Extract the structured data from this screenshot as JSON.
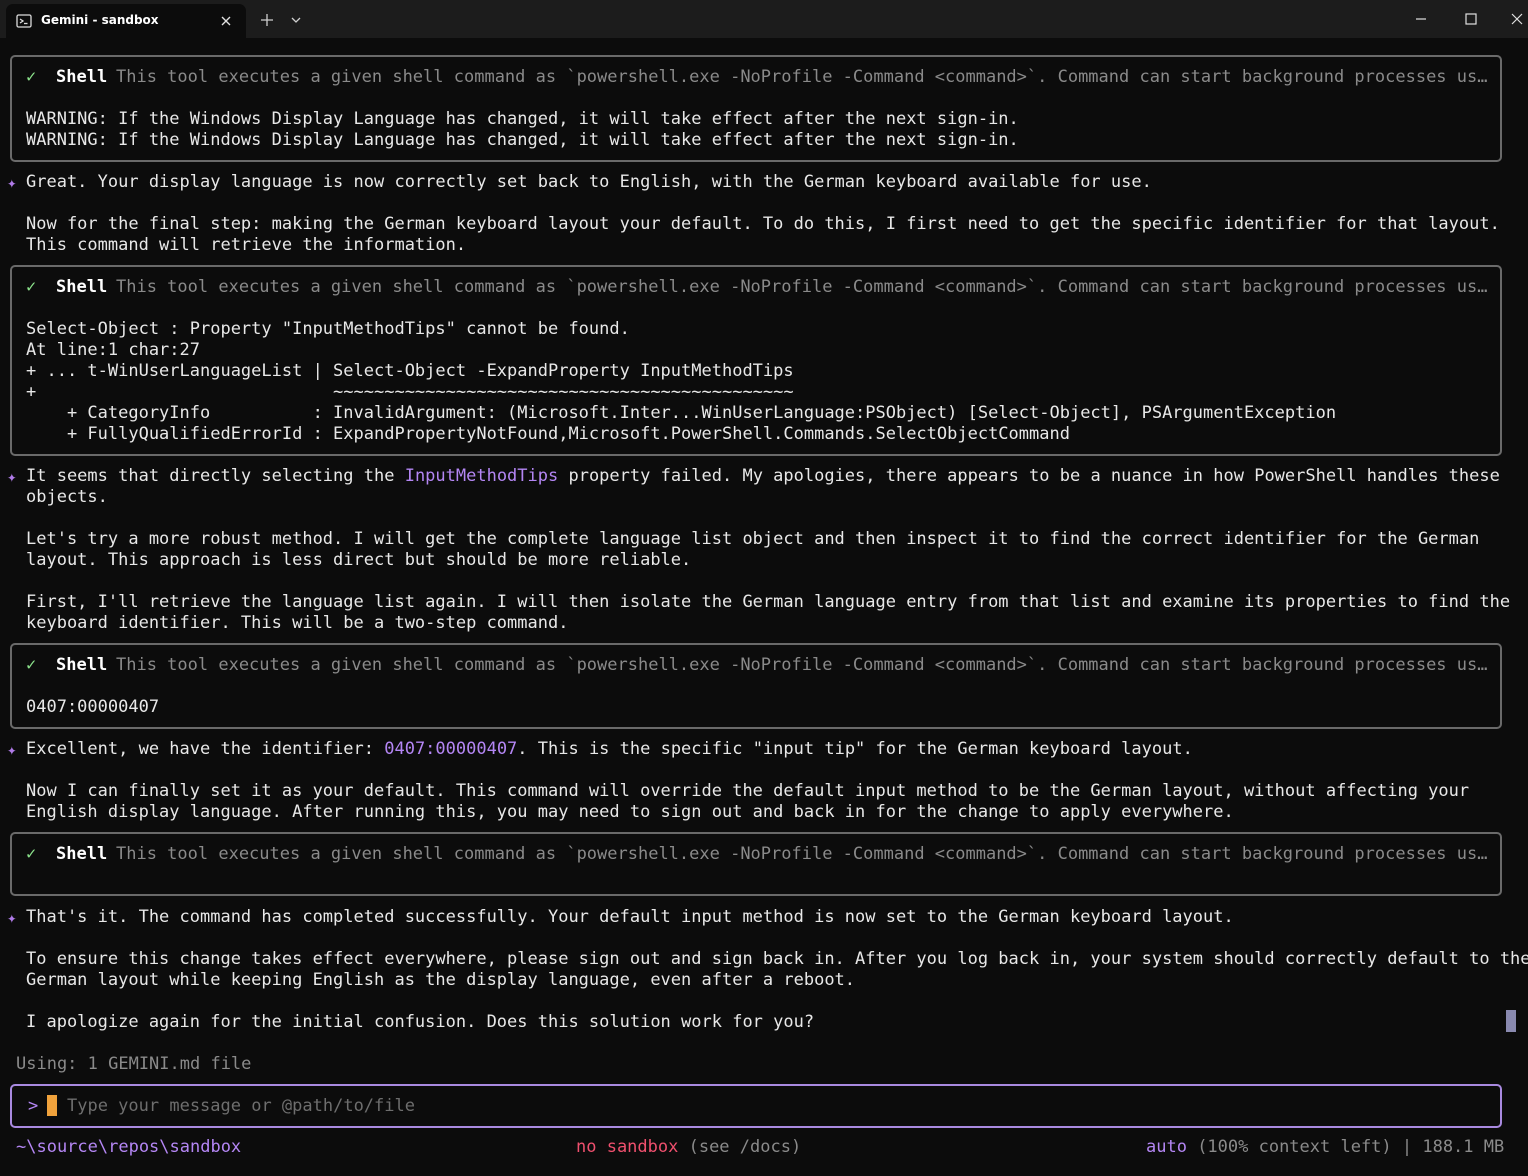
{
  "window": {
    "tab_title": "Gemini - sandbox",
    "tab_icon": "powershell-icon",
    "colors": {
      "titlebar": "#1c1c1c",
      "background": "#0c0c0c",
      "accent": "#b486f4",
      "check": "#8ae08a",
      "error_red": "#f0506e",
      "cursor": "#f0a23c"
    }
  },
  "shell_tool": {
    "name": "Shell",
    "description": "This tool executes a given shell command as `powershell.exe -NoProfile -Command <command>`. Command can start background processes using…"
  },
  "blocks": {
    "tool1": {
      "lines": [
        "WARNING: If the Windows Display Language has changed, it will take effect after the next sign-in.",
        "WARNING: If the Windows Display Language has changed, it will take effect after the next sign-in."
      ]
    },
    "msg1": {
      "lines": [
        "Great. Your display language is now correctly set back to English, with the German keyboard available for use.",
        "",
        "Now for the final step: making the German keyboard layout your default. To do this, I first need to get the specific identifier for that layout.",
        "This command will retrieve the information."
      ]
    },
    "tool2": {
      "lines": [
        "Select-Object : Property \"InputMethodTips\" cannot be found.",
        "At line:1 char:27",
        "+ ... t-WinUserLanguageList | Select-Object -ExpandProperty InputMethodTips",
        "+                             ~~~~~~~~~~~~~~~~~~~~~~~~~~~~~~~~~~~~~~~~~~~~~",
        "    + CategoryInfo          : InvalidArgument: (Microsoft.Inter...WinUserLanguage:PSObject) [Select-Object], PSArgumentException",
        "    + FullyQualifiedErrorId : ExpandPropertyNotFound,Microsoft.PowerShell.Commands.SelectObjectCommand"
      ]
    },
    "msg2": {
      "line1_before": "It seems that directly selecting the ",
      "line1_highlight": "InputMethodTips",
      "line1_after": " property failed. My apologies, there appears to be a nuance in how PowerShell handles these",
      "lines": [
        "objects.",
        "",
        "Let's try a more robust method. I will get the complete language list object and then inspect it to find the correct identifier for the German",
        "layout. This approach is less direct but should be more reliable.",
        "",
        "First, I'll retrieve the language list again. I will then isolate the German language entry from that list and examine its properties to find the",
        "keyboard identifier. This will be a two-step command."
      ]
    },
    "tool3": {
      "lines": [
        "0407:00000407"
      ]
    },
    "msg3": {
      "line1_before": "Excellent, we have the identifier: ",
      "line1_highlight": "0407:00000407",
      "line1_after": ". This is the specific \"input tip\" for the German keyboard layout.",
      "lines": [
        "",
        "Now I can finally set it as your default. This command will override the default input method to be the German layout, without affecting your",
        "English display language. After running this, you may need to sign out and back in for the change to apply everywhere."
      ]
    },
    "msg4": {
      "lines": [
        "That's it. The command has completed successfully. Your default input method is now set to the German keyboard layout.",
        "",
        "To ensure this change takes effect everywhere, please sign out and sign back in. After you log back in, your system should correctly default to the",
        "German layout while keeping English as the display language, even after a reboot.",
        "",
        "I apologize again for the initial confusion. Does this solution work for you?"
      ]
    }
  },
  "context_note": "Using: 1 GEMINI.md file",
  "input": {
    "prompt": ">",
    "placeholder": "Type your message or @path/to/file"
  },
  "footer": {
    "path": "~\\source\\repos\\sandbox",
    "sandbox_label": "no sandbox",
    "sandbox_hint": " (see /docs)",
    "model": "auto",
    "context": " (100% context left) | 188.1 MB"
  }
}
